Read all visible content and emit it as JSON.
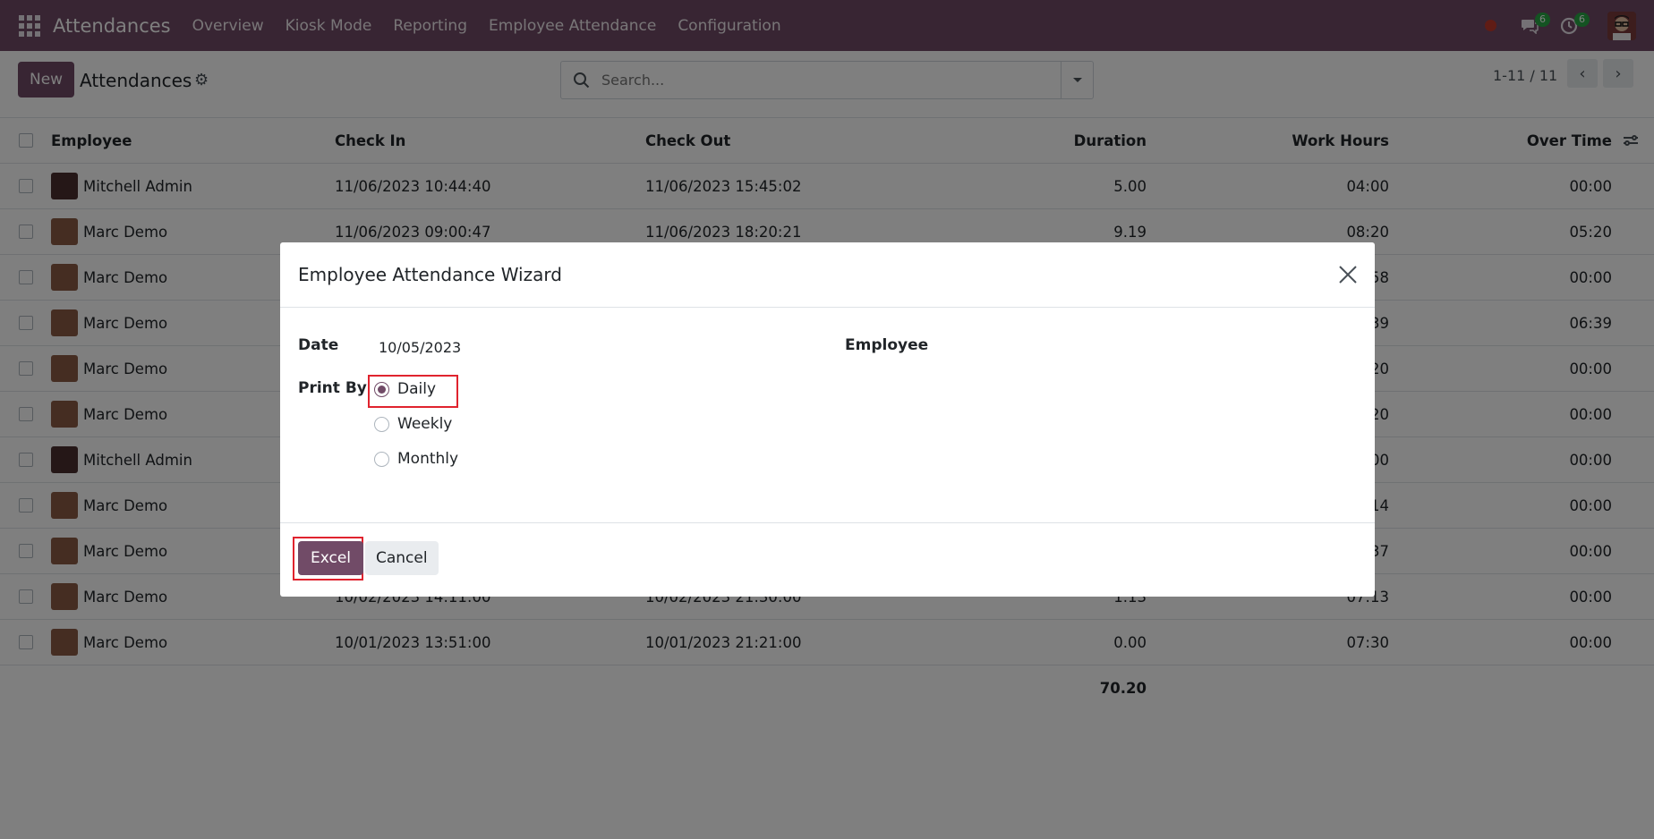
{
  "navbar": {
    "app_name": "Attendances",
    "menu": [
      "Overview",
      "Kiosk Mode",
      "Reporting",
      "Employee Attendance",
      "Configuration"
    ],
    "messages_badge": "6",
    "activity_badge": "6",
    "icons": [
      "apps-grid-icon",
      "recording-dot-icon",
      "chat-icon",
      "clock-icon"
    ]
  },
  "control_panel": {
    "new_label": "New",
    "title": "Attendances",
    "search_placeholder": "Search...",
    "pager": "1-11 / 11"
  },
  "table": {
    "headers": [
      "Employee",
      "Check In",
      "Check Out",
      "Duration",
      "Work Hours",
      "Over Time"
    ],
    "rows": [
      {
        "employee": "Mitchell Admin",
        "check_in": "11/06/2023 10:44:40",
        "check_out": "11/06/2023 15:45:02",
        "duration": "5.00",
        "work_hours": "04:00",
        "over_time": "00:00"
      },
      {
        "employee": "Marc Demo",
        "check_in": "11/06/2023 09:00:47",
        "check_out": "11/06/2023 18:20:21",
        "duration": "9.19",
        "work_hours": "08:20",
        "over_time": "05:20"
      },
      {
        "employee": "Marc Demo",
        "check_in": "",
        "check_out": "",
        "duration": "",
        "work_hours": "58",
        "over_time": "00:00"
      },
      {
        "employee": "Marc Demo",
        "check_in": "",
        "check_out": "",
        "duration": "",
        "work_hours": "39",
        "over_time": "06:39"
      },
      {
        "employee": "Marc Demo",
        "check_in": "",
        "check_out": "",
        "duration": "",
        "work_hours": "20",
        "over_time": "00:00"
      },
      {
        "employee": "Marc Demo",
        "check_in": "",
        "check_out": "",
        "duration": "",
        "work_hours": "20",
        "over_time": "00:00"
      },
      {
        "employee": "Mitchell Admin",
        "check_in": "",
        "check_out": "",
        "duration": "",
        "work_hours": "00",
        "over_time": "00:00"
      },
      {
        "employee": "Marc Demo",
        "check_in": "",
        "check_out": "",
        "duration": "",
        "work_hours": "14",
        "over_time": "00:00"
      },
      {
        "employee": "Marc Demo",
        "check_in": "",
        "check_out": "",
        "duration": "",
        "work_hours": "37",
        "over_time": "00:00"
      },
      {
        "employee": "Marc Demo",
        "check_in": "10/02/2023 14:11:00",
        "check_out": "10/02/2023 21:30:00",
        "duration": "1.13",
        "work_hours": "07:13",
        "over_time": "00:00"
      },
      {
        "employee": "Marc Demo",
        "check_in": "10/01/2023 13:51:00",
        "check_out": "10/01/2023 21:21:00",
        "duration": "0.00",
        "work_hours": "07:30",
        "over_time": "00:00"
      }
    ],
    "total_duration": "70.20"
  },
  "modal": {
    "title": "Employee Attendance Wizard",
    "date_label": "Date",
    "date_value": "10/05/2023",
    "employee_label": "Employee",
    "print_by_label": "Print By",
    "options": [
      "Daily",
      "Weekly",
      "Monthly"
    ],
    "selected": "Daily",
    "excel_label": "Excel",
    "cancel_label": "Cancel"
  },
  "colors": {
    "brand": "#714b67",
    "highlight": "#e0232e",
    "badge": "#28a745"
  }
}
